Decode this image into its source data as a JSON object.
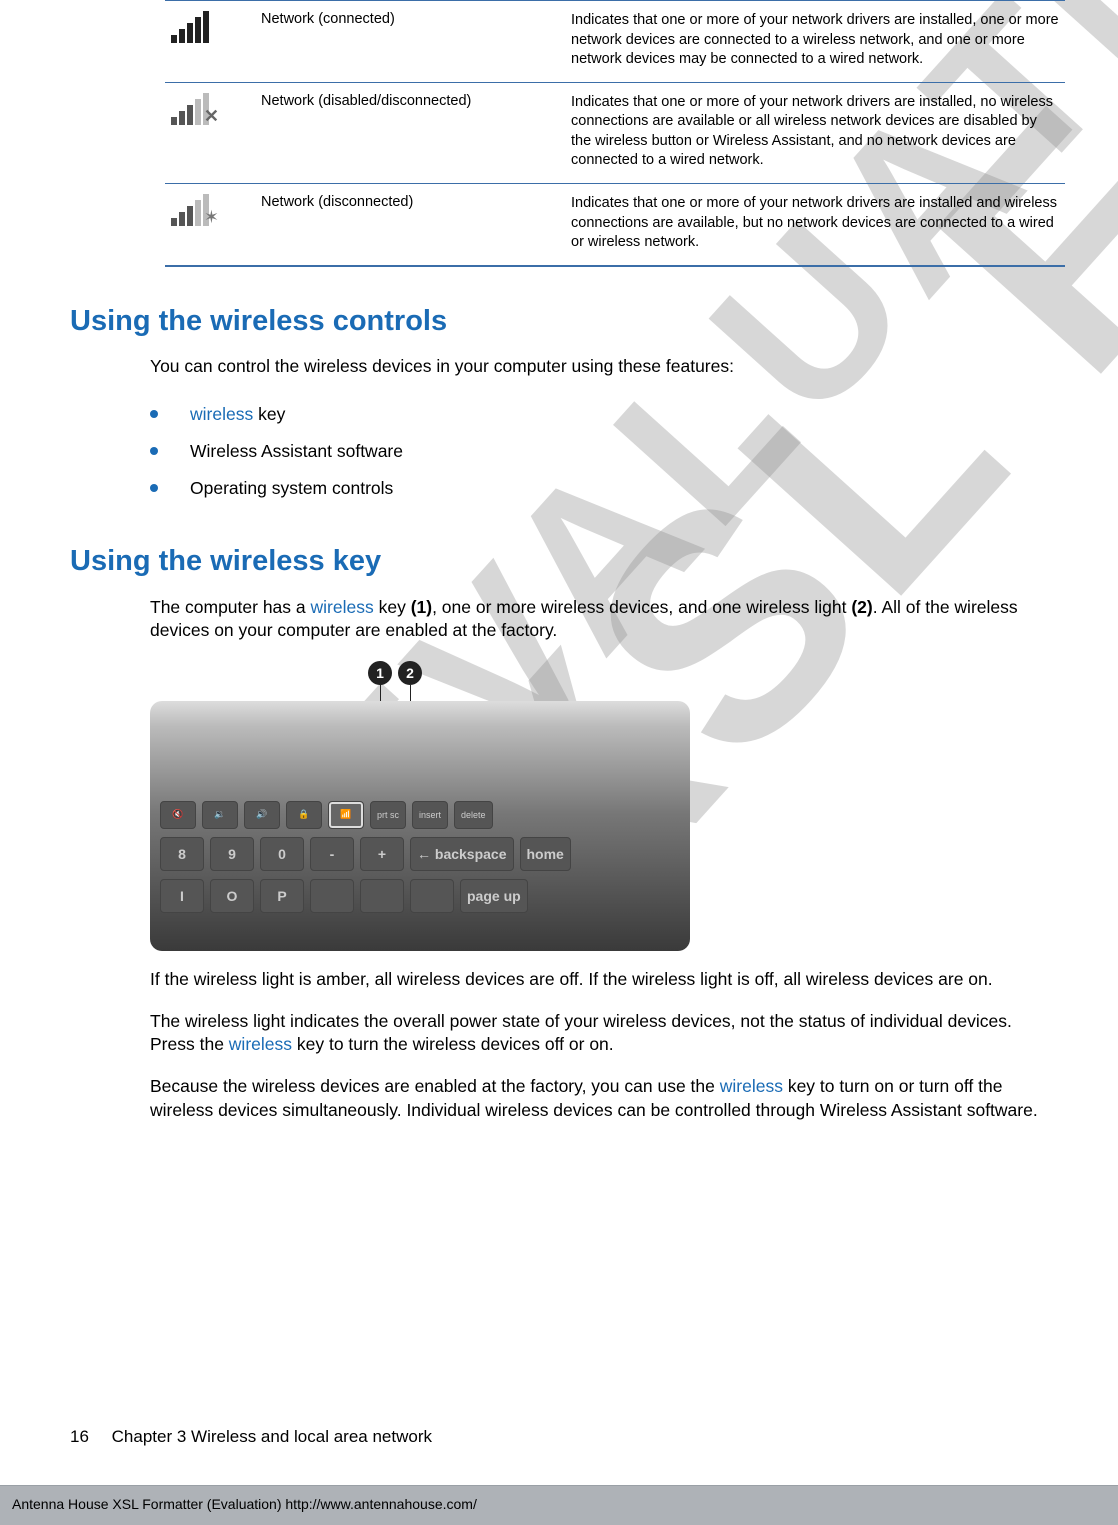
{
  "watermarks": {
    "large": "XSL Formatter",
    "small": "EVALUATION"
  },
  "table": {
    "rows": [
      {
        "label": "Network (connected)",
        "desc": "Indicates that one or more of your network drivers are installed, one or more network devices are connected to a wireless network, and one or more network devices may be connected to a wired network."
      },
      {
        "label": "Network (disabled/disconnected)",
        "desc": "Indicates that one or more of your network drivers are installed, no wireless connections are available or all wireless network devices are disabled by the wireless button or Wireless Assistant, and no network devices are connected to a wired network."
      },
      {
        "label": "Network (disconnected)",
        "desc": "Indicates that one or more of your network drivers are installed and wireless connections are available, but no network devices are connected to a wired or wireless network."
      }
    ]
  },
  "sections": {
    "s1_title": "Using the wireless controls",
    "s1_intro": "You can control the wireless devices in your computer using these features:",
    "bullets": {
      "b1_link": "wireless",
      "b1_rest": " key",
      "b2": "Wireless Assistant software",
      "b3": "Operating system controls"
    },
    "s2_title": "Using the wireless key",
    "s2_p1_a": "The computer has a ",
    "s2_p1_link": "wireless",
    "s2_p1_b": " key ",
    "s2_p1_bold1": "(1)",
    "s2_p1_c": ", one or more wireless devices, and one wireless light ",
    "s2_p1_bold2": "(2)",
    "s2_p1_d": ". All of the wireless devices on your computer are enabled at the factory.",
    "callout1": "1",
    "callout2": "2",
    "keys": {
      "fn": [
        "",
        "",
        "",
        "",
        "prt sc",
        "insert",
        "delete"
      ],
      "mid": [
        "8",
        "9",
        "0",
        "-",
        "+",
        "← backspace",
        "home"
      ],
      "low": [
        "I",
        "O",
        "P",
        "",
        "",
        "",
        "page up"
      ]
    },
    "s2_p2": "If the wireless light is amber, all wireless devices are off. If the wireless light is off, all wireless devices are on.",
    "s2_p3_a": "The wireless light indicates the overall power state of your wireless devices, not the status of individual devices. Press the ",
    "s2_p3_link": "wireless",
    "s2_p3_b": " key to turn the wireless devices off or on.",
    "s2_p4_a": "Because the wireless devices are enabled at the factory, you can use the ",
    "s2_p4_link": "wireless",
    "s2_p4_b": " key to turn on or turn off the wireless devices simultaneously. Individual wireless devices can be controlled through Wireless Assistant software."
  },
  "footer": {
    "page_num": "16",
    "chapter": "Chapter 3   Wireless and local area network"
  },
  "eval_bar": "Antenna House XSL Formatter (Evaluation)  http://www.antennahouse.com/"
}
